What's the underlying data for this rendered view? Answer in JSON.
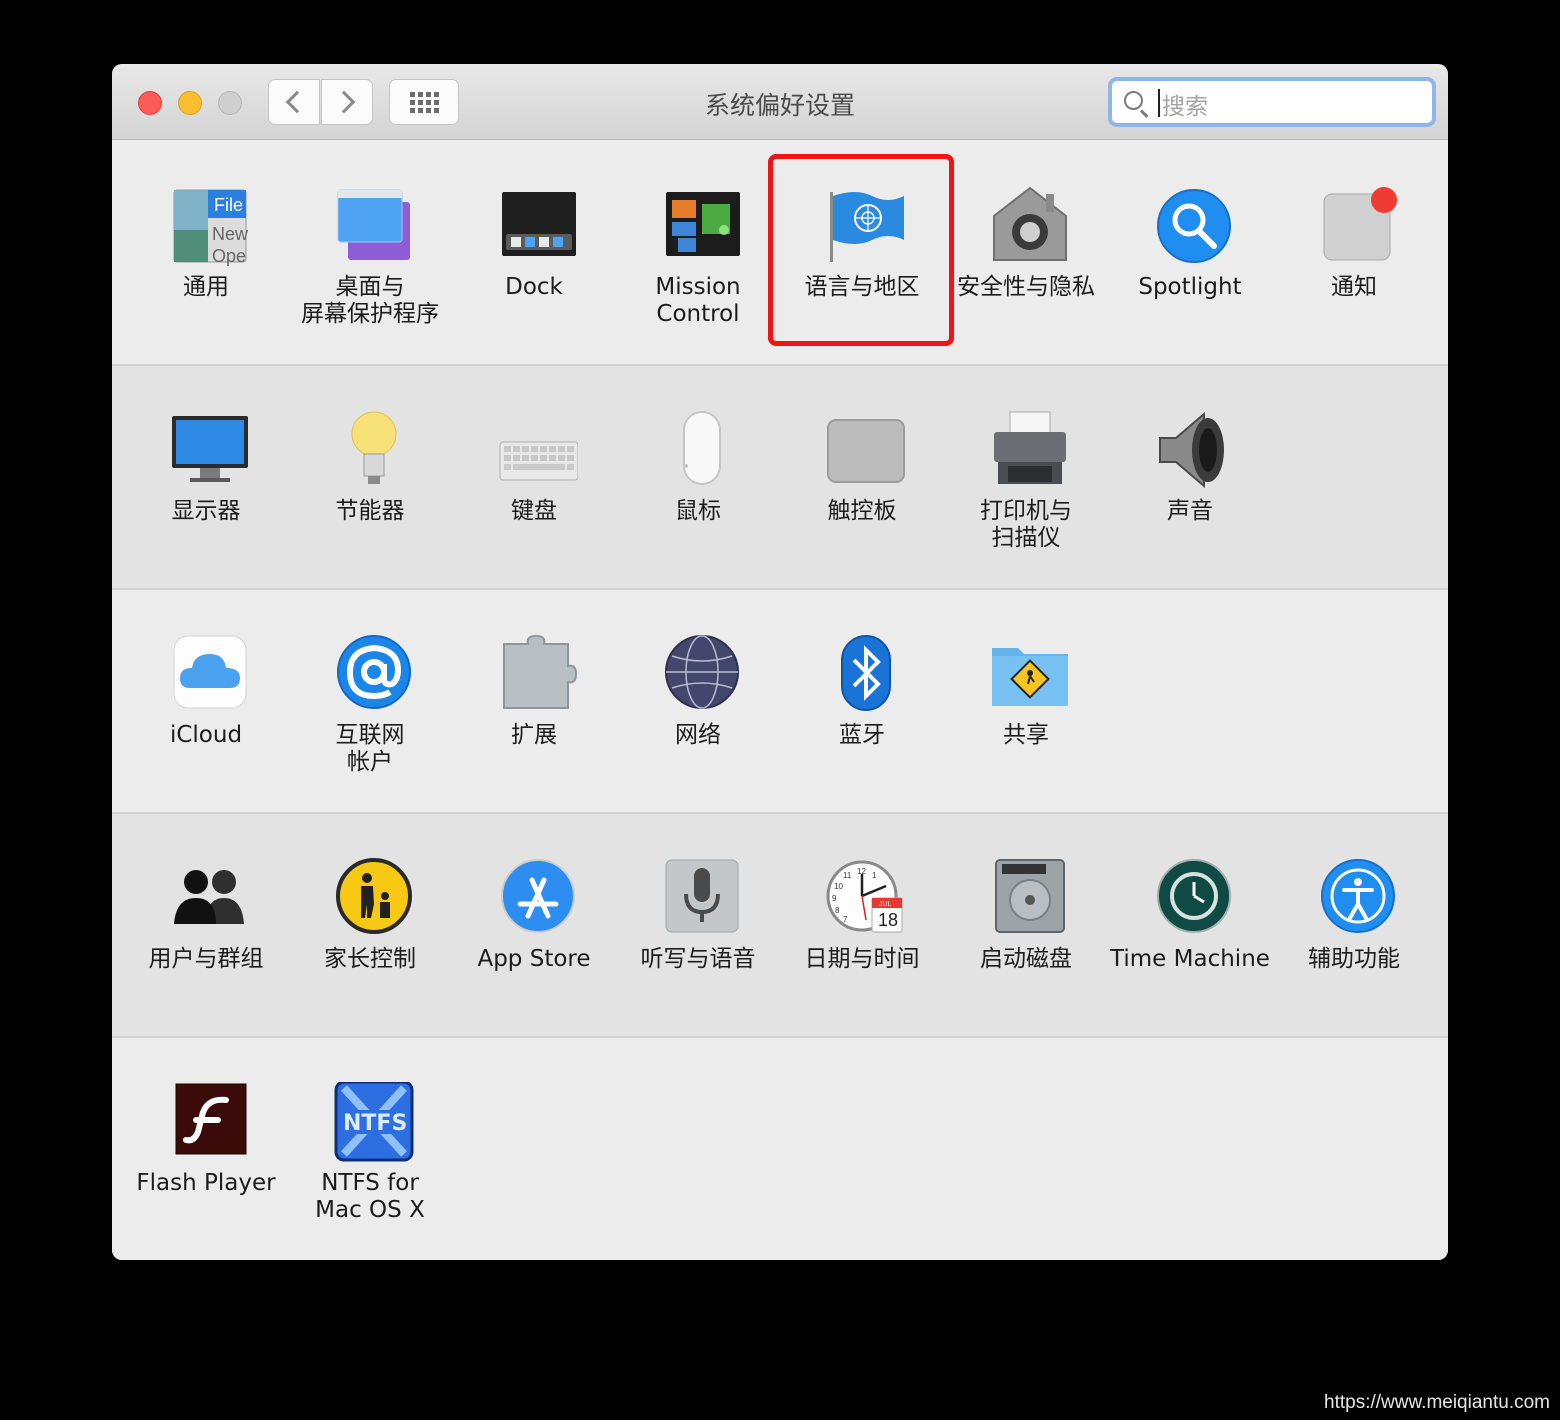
{
  "window": {
    "title": "系统偏好设置"
  },
  "search": {
    "placeholder": "搜索"
  },
  "rows": [
    [
      {
        "label": "通用",
        "icon": "general-icon"
      },
      {
        "label": "桌面与\n屏幕保护程序",
        "icon": "desktop-screensaver-icon"
      },
      {
        "label": "Dock",
        "icon": "dock-icon"
      },
      {
        "label": "Mission\nControl",
        "icon": "mission-control-icon"
      },
      {
        "label": "语言与地区",
        "icon": "language-region-icon"
      },
      {
        "label": "安全性与隐私",
        "icon": "security-privacy-icon"
      },
      {
        "label": "Spotlight",
        "icon": "spotlight-icon"
      },
      {
        "label": "通知",
        "icon": "notifications-icon"
      }
    ],
    [
      {
        "label": "显示器",
        "icon": "displays-icon"
      },
      {
        "label": "节能器",
        "icon": "energy-saver-icon"
      },
      {
        "label": "键盘",
        "icon": "keyboard-icon"
      },
      {
        "label": "鼠标",
        "icon": "mouse-icon"
      },
      {
        "label": "触控板",
        "icon": "trackpad-icon"
      },
      {
        "label": "打印机与\n扫描仪",
        "icon": "printers-scanners-icon"
      },
      {
        "label": "声音",
        "icon": "sound-icon"
      }
    ],
    [
      {
        "label": "iCloud",
        "icon": "icloud-icon"
      },
      {
        "label": "互联网\n帐户",
        "icon": "internet-accounts-icon"
      },
      {
        "label": "扩展",
        "icon": "extensions-icon"
      },
      {
        "label": "网络",
        "icon": "network-icon"
      },
      {
        "label": "蓝牙",
        "icon": "bluetooth-icon"
      },
      {
        "label": "共享",
        "icon": "sharing-icon"
      }
    ],
    [
      {
        "label": "用户与群组",
        "icon": "users-groups-icon"
      },
      {
        "label": "家长控制",
        "icon": "parental-controls-icon"
      },
      {
        "label": "App Store",
        "icon": "app-store-icon"
      },
      {
        "label": "听写与语音",
        "icon": "dictation-speech-icon"
      },
      {
        "label": "日期与时间",
        "icon": "date-time-icon"
      },
      {
        "label": "启动磁盘",
        "icon": "startup-disk-icon"
      },
      {
        "label": "Time Machine",
        "icon": "time-machine-icon"
      },
      {
        "label": "辅助功能",
        "icon": "accessibility-icon"
      }
    ],
    [
      {
        "label": "Flash Player",
        "icon": "flash-player-icon"
      },
      {
        "label": "NTFS for\nMac OS X",
        "icon": "ntfs-icon"
      }
    ]
  ],
  "icon_text": {
    "general": [
      "File",
      "New",
      "Ope"
    ],
    "date_month": "JUL",
    "date_day": "18",
    "ntfs": "NTFS",
    "clock_12": "12",
    "clock_1": "1",
    "clock_11": "11",
    "clock_10": "10",
    "clock_9": "9",
    "clock_8": "8",
    "clock_7": "7"
  },
  "watermark": "https://www.meiqiantu.com"
}
